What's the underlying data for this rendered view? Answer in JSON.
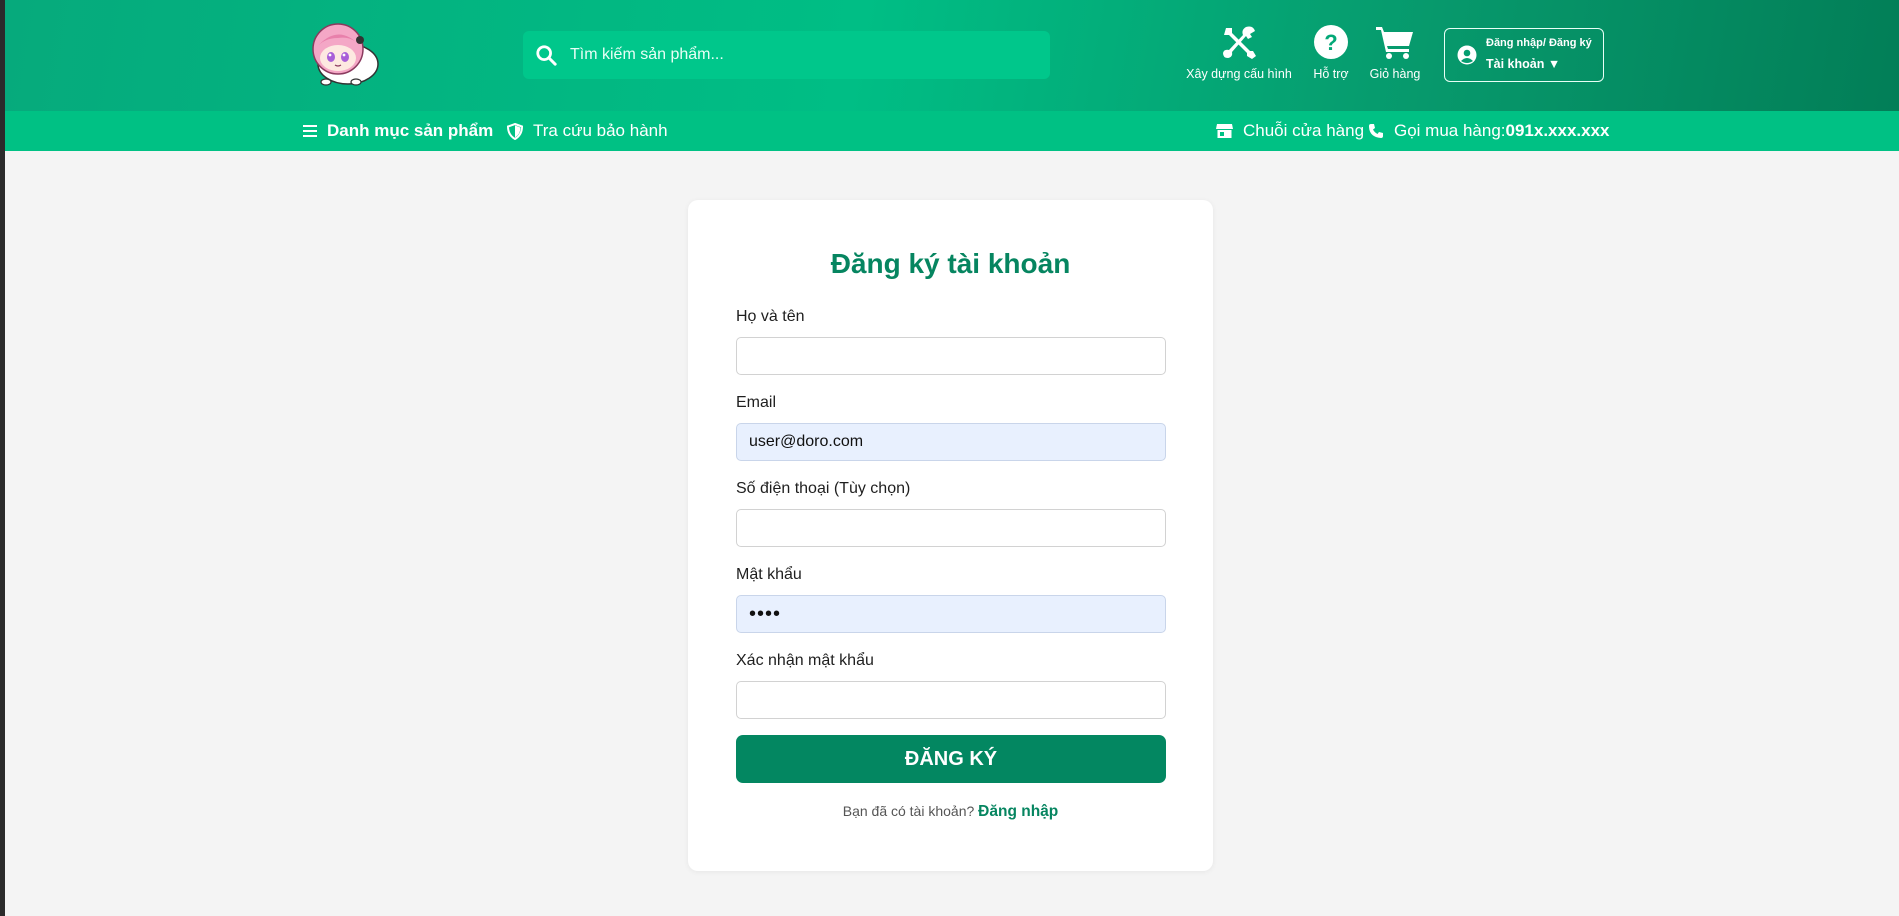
{
  "header": {
    "logo_icon": "anime-mascot-logo",
    "search": {
      "placeholder": "Tìm kiếm sản phẩm...",
      "value": ""
    },
    "actions": [
      {
        "label": "Xây dựng cấu hình",
        "icon": "tools-icon"
      },
      {
        "label": "Hỗ trợ",
        "icon": "help-icon"
      },
      {
        "label": "Giỏ hàng",
        "icon": "cart-icon"
      }
    ],
    "account": {
      "line1": "Đăng nhập/ Đăng ký",
      "line2": "Tài khoản ▼"
    }
  },
  "nav": {
    "categories": "Danh mục sản phẩm",
    "warranty": "Tra cứu bảo hành",
    "stores": "Chuỗi cửa hàng",
    "call_label": "Gọi mua hàng: ",
    "call_number": "091x.xxx.xxx"
  },
  "form": {
    "title": "Đăng ký tài khoản",
    "fields": [
      {
        "label": "Họ và tên",
        "value": ""
      },
      {
        "label": "Email",
        "value": "user@doro.com"
      },
      {
        "label": "Số điện thoại (Tùy chọn)",
        "value": ""
      },
      {
        "label": "Mật khẩu",
        "value": "••••"
      },
      {
        "label": "Xác nhận mật khẩu",
        "value": ""
      }
    ],
    "submit": "ĐĂNG KÝ",
    "login_prompt": "Bạn đã có tài khoản? ",
    "login_link": "Đăng nhập"
  },
  "colors": {
    "primary": "#038761",
    "header": "#00be85",
    "nav": "#00c184",
    "background": "#f4f4f4"
  }
}
